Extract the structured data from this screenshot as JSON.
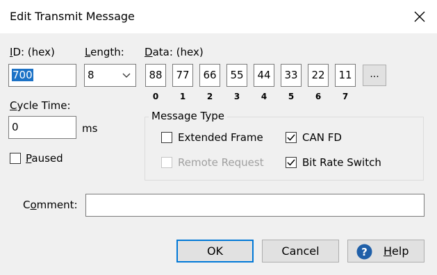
{
  "window": {
    "title": "Edit Transmit Message"
  },
  "id_field": {
    "label_mnemonic": "I",
    "label_rest": "D: (hex)",
    "value": "700"
  },
  "length": {
    "label_mnemonic": "L",
    "label_rest": "ength:",
    "value": "8"
  },
  "data": {
    "label_mnemonic": "D",
    "label_rest": "ata: (hex)",
    "bytes": [
      "88",
      "77",
      "66",
      "55",
      "44",
      "33",
      "22",
      "11"
    ],
    "indices": [
      "0",
      "1",
      "2",
      "3",
      "4",
      "5",
      "6",
      "7"
    ],
    "more_label": "..."
  },
  "cycle_time": {
    "label_mnemonic": "C",
    "label_rest": "ycle Time:",
    "value": "0",
    "unit": "ms"
  },
  "paused": {
    "label_mnemonic": "P",
    "label_rest": "aused",
    "checked": false
  },
  "message_type": {
    "label": "Message Type",
    "extended_frame": {
      "label": "Extended Frame",
      "checked": false,
      "enabled": true
    },
    "remote_request": {
      "label": "Remote Request",
      "checked": false,
      "enabled": false
    },
    "can_fd": {
      "label": "CAN FD",
      "checked": true,
      "enabled": true
    },
    "bit_rate_switch": {
      "label": "Bit Rate Switch",
      "checked": true,
      "enabled": true
    }
  },
  "comment": {
    "label_pre": "C",
    "label_mnemonic": "o",
    "label_rest": "mment:",
    "value": ""
  },
  "buttons": {
    "ok": "OK",
    "cancel": "Cancel",
    "help_mnemonic": "H",
    "help_rest": "elp"
  },
  "colors": {
    "accent": "#0078d7",
    "selection": "#1c72c6",
    "help_icon": "#1f5fa8"
  }
}
